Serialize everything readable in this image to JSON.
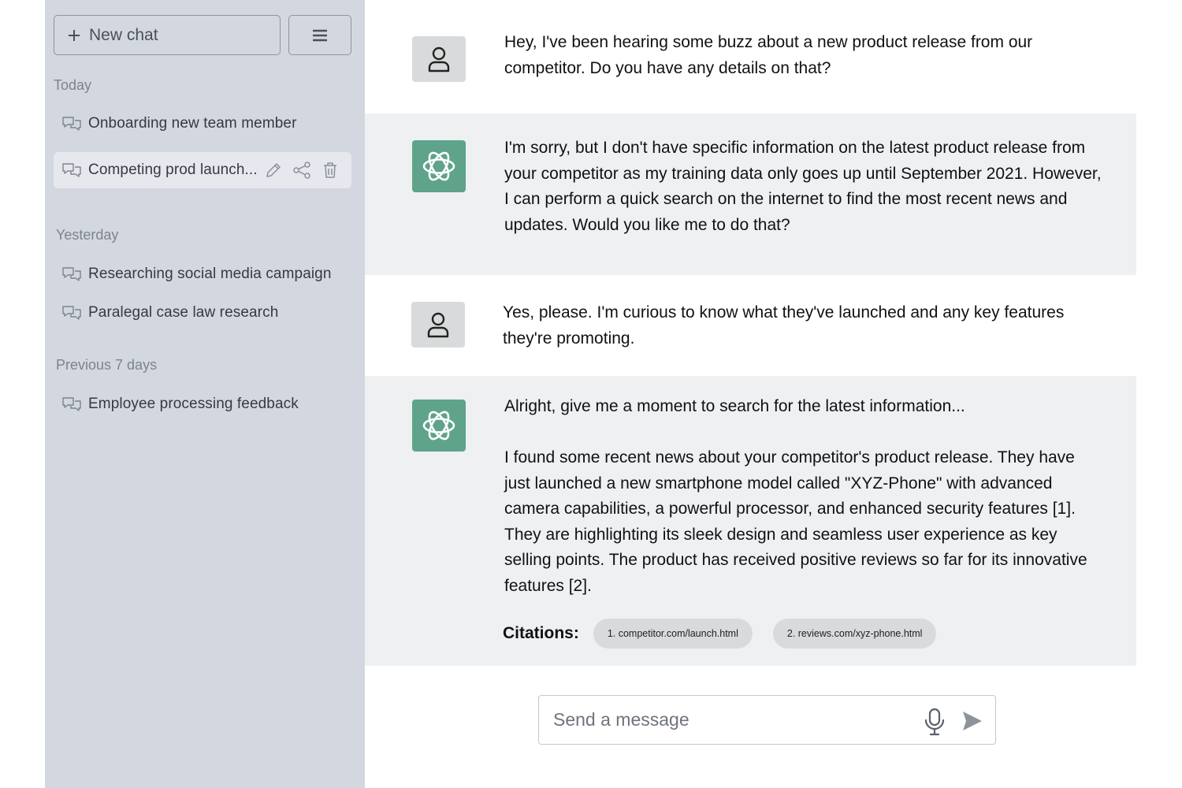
{
  "sidebar": {
    "new_chat_label": "New chat",
    "sections": [
      {
        "label": "Today"
      },
      {
        "label": "Yesterday"
      },
      {
        "label": "Previous 7 days"
      }
    ],
    "chats": [
      {
        "title": "Onboarding new team member"
      },
      {
        "title": "Competing prod launch..."
      },
      {
        "title": "Researching social media campaign"
      },
      {
        "title": "Paralegal case law research"
      },
      {
        "title": "Employee processing feedback"
      }
    ]
  },
  "conversation": [
    {
      "role": "user",
      "paragraphs": [
        "Hey, I've been hearing some buzz about a new product release from our competitor. Do you have any details on that?"
      ]
    },
    {
      "role": "assistant",
      "paragraphs": [
        "I'm sorry, but I don't have specific information on the latest product release from your competitor as my training data only goes up until September 2021. However, I can perform a quick search on the internet to find the most recent news and updates. Would you like me to do that?"
      ]
    },
    {
      "role": "user",
      "paragraphs": [
        "Yes, please. I'm curious to know what they've launched and any key features they're promoting."
      ]
    },
    {
      "role": "assistant",
      "paragraphs": [
        "Alright, give me a moment to search for the latest information...",
        "I found some recent news about your competitor's product release. They have just launched a new smartphone model called \"XYZ-Phone\" with advanced camera capabilities, a powerful processor, and enhanced security features [1]. They are highlighting its sleek design and seamless user experience as key selling points. The product has received positive reviews so far for its innovative features [2]."
      ]
    }
  ],
  "citations": {
    "label": "Citations:",
    "items": [
      "1. competitor.com/launch.html",
      "2. reviews.com/xyz-phone.html"
    ]
  },
  "composer": {
    "placeholder": "Send a message"
  },
  "colors": {
    "sidebar_bg": "#d3d7e0",
    "assistant_bg": "#eef0f2",
    "assistant_avatar": "#5fa38b",
    "user_avatar": "#d9dadb"
  },
  "icons": {
    "new_chat": "plus-icon",
    "menu": "hamburger-icon",
    "chat_item": "chat-bubbles-icon",
    "rename": "pencil-icon",
    "share": "share-icon",
    "delete": "trash-icon",
    "user_avatar": "person-icon",
    "assistant_avatar": "openai-logo-icon",
    "voice": "microphone-icon",
    "send": "send-icon"
  }
}
